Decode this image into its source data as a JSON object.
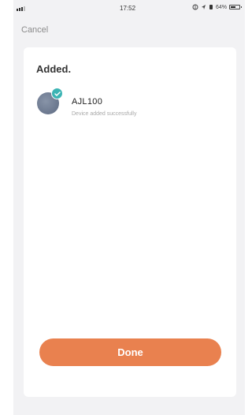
{
  "status_bar": {
    "time": "17:52",
    "battery_text": "64%",
    "battery_level": 0.64,
    "icons": [
      "signal-icon",
      "lock-icon",
      "location-icon",
      "alarm-icon",
      "battery-icon"
    ]
  },
  "nav": {
    "cancel_label": "Cancel"
  },
  "card": {
    "title": "Added.",
    "device": {
      "name": "AJL100",
      "status": "Device added successfully",
      "badge_icon": "check-icon"
    }
  },
  "actions": {
    "done_label": "Done"
  },
  "colors": {
    "accent": "#e9814f",
    "badge": "#3cb4b4",
    "background": "#f2f2f4"
  }
}
